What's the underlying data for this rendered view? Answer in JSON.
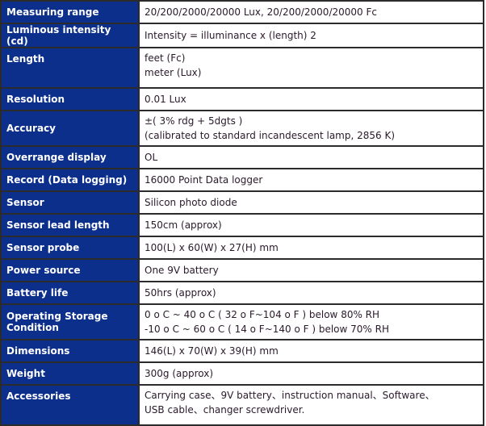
{
  "specs": [
    {
      "label": "Measuring range",
      "lines": [
        "20/200/2000/20000 Lux, 20/200/2000/20000 Fc"
      ]
    },
    {
      "label": "Luminous intensity (cd)",
      "lines": [
        "Intensity = illuminance x (length) 2"
      ]
    },
    {
      "label": "Length",
      "lines": [
        "feet (Fc)",
        "meter (Lux)"
      ]
    },
    {
      "label": "Resolution",
      "lines": [
        "0.01 Lux"
      ]
    },
    {
      "label": "Accuracy",
      "lines": [
        "±( 3% rdg + 5dgts )",
        "(calibrated to standard incandescent lamp, 2856 K)"
      ]
    },
    {
      "label": "Overrange display",
      "lines": [
        "OL"
      ]
    },
    {
      "label": "Record (Data logging)",
      "lines": [
        "16000 Point Data logger"
      ]
    },
    {
      "label": "Sensor",
      "lines": [
        "Silicon photo diode"
      ]
    },
    {
      "label": "Sensor lead length",
      "lines": [
        "150cm (approx)"
      ]
    },
    {
      "label": "Sensor probe",
      "lines": [
        "100(L) x 60(W) x 27(H) mm"
      ]
    },
    {
      "label": "Power source",
      "lines": [
        "One 9V battery"
      ]
    },
    {
      "label": "Battery life",
      "lines": [
        "50hrs (approx)"
      ]
    },
    {
      "label": "Operating Storage Condition",
      "lines": [
        "0 o C ~ 40 o C ( 32 o F~104 o F ) below 80% RH",
        "-10 o C ~ 60 o C ( 14 o F~140 o F ) below 70% RH"
      ]
    },
    {
      "label": "Dimensions",
      "lines": [
        "146(L) x 70(W) x 39(H) mm"
      ]
    },
    {
      "label": "Weight",
      "lines": [
        "300g (approx)"
      ]
    },
    {
      "label": "Accessories",
      "lines": [
        "Carrying case、9V battery、instruction manual、Software、",
        "USB cable、changer screwdriver."
      ]
    }
  ],
  "colors": {
    "label_bg": "#0c2f8c",
    "label_text": "#ffffff",
    "value_text": "#2a1a2a",
    "border": "#2b2b2b"
  }
}
